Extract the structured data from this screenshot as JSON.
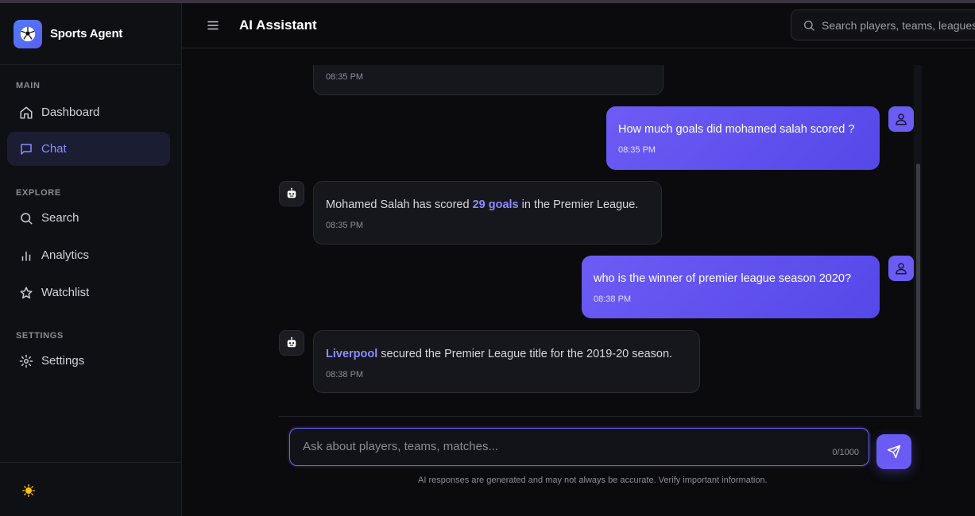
{
  "brand": {
    "name": "Sports Agent"
  },
  "sidebar": {
    "sections": [
      {
        "label": "MAIN"
      },
      {
        "label": "EXPLORE"
      },
      {
        "label": "SETTINGS"
      }
    ],
    "items": [
      {
        "label": "Dashboard",
        "icon": "home-icon"
      },
      {
        "label": "Chat",
        "icon": "chat-icon",
        "active": true
      },
      {
        "label": "Search",
        "icon": "search-icon"
      },
      {
        "label": "Analytics",
        "icon": "bar-chart-icon"
      },
      {
        "label": "Watchlist",
        "icon": "star-icon"
      },
      {
        "label": "Settings",
        "icon": "gear-icon"
      }
    ],
    "theme_toggle_icon": "sun-icon"
  },
  "header": {
    "title": "AI Assistant",
    "search_placeholder": "Search players, teams, leagues..."
  },
  "messages": [
    {
      "role": "ai",
      "time": "08:35 PM"
    },
    {
      "role": "user",
      "text": "How much goals did mohamed salah scored ?",
      "time": "08:35 PM"
    },
    {
      "role": "ai",
      "text_before": "Mohamed Salah has scored ",
      "highlight": "29 goals",
      "text_after": " in the Premier League.",
      "time": "08:35 PM"
    },
    {
      "role": "user",
      "text": "who is the winner of premier league season 2020?",
      "time": "08:38 PM"
    },
    {
      "role": "ai",
      "highlight": "Liverpool",
      "text_after": " secured the Premier League title for the 2019-20 season.",
      "time": "08:38 PM"
    }
  ],
  "composer": {
    "placeholder": "Ask about players, teams, matches...",
    "value": "",
    "counter": "0/1000",
    "disclaimer": "AI responses are generated and may not always be accurate. Verify important information."
  },
  "colors": {
    "accent": "#6a5cf2",
    "highlight": "#8f8cff",
    "background": "#0b0b0e",
    "sidebar": "#0f1014"
  }
}
